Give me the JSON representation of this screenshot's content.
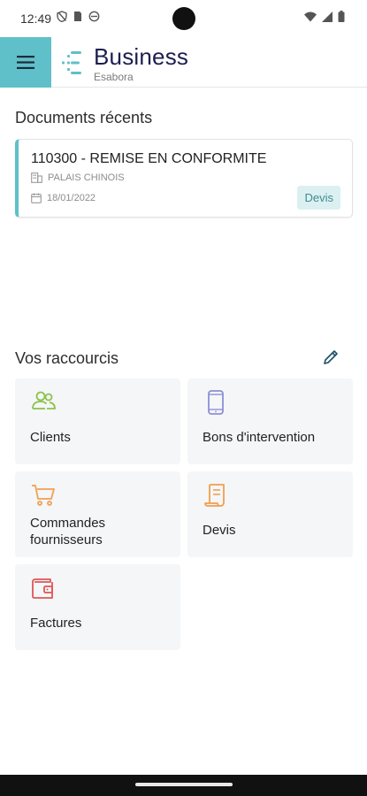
{
  "status_bar": {
    "time": "12:49",
    "left_icons": [
      "shield-off-icon",
      "sim-card-icon",
      "circle-clock-icon"
    ],
    "right_icons": [
      "wifi-icon",
      "signal-icon",
      "battery-icon"
    ]
  },
  "app_bar": {
    "title": "Business",
    "subtitle": "Esabora",
    "menu_icon": "hamburger-menu-icon",
    "accent_color": "#5fc0c9",
    "title_color": "#1d1e4f"
  },
  "recent": {
    "section_title": "Documents récents",
    "documents": [
      {
        "title": "110300 - REMISE EN CONFORMITE",
        "location": "PALAIS CHINOIS",
        "date": "18/01/2022",
        "badge": "Devis"
      }
    ]
  },
  "shortcuts": {
    "section_title": "Vos raccourcis",
    "edit_icon": "pencil-icon",
    "items": [
      {
        "label": "Clients",
        "icon": "users-icon",
        "color": "#8bc34a"
      },
      {
        "label": "Bons d'intervention",
        "icon": "smartphone-icon",
        "color": "#8e8fd6"
      },
      {
        "label": "Commandes fournisseurs",
        "icon": "shopping-cart-icon",
        "color": "#f0a050"
      },
      {
        "label": "Devis",
        "icon": "quote-document-icon",
        "color": "#f0a050"
      },
      {
        "label": "Factures",
        "icon": "wallet-icon",
        "color": "#e05555"
      }
    ]
  }
}
